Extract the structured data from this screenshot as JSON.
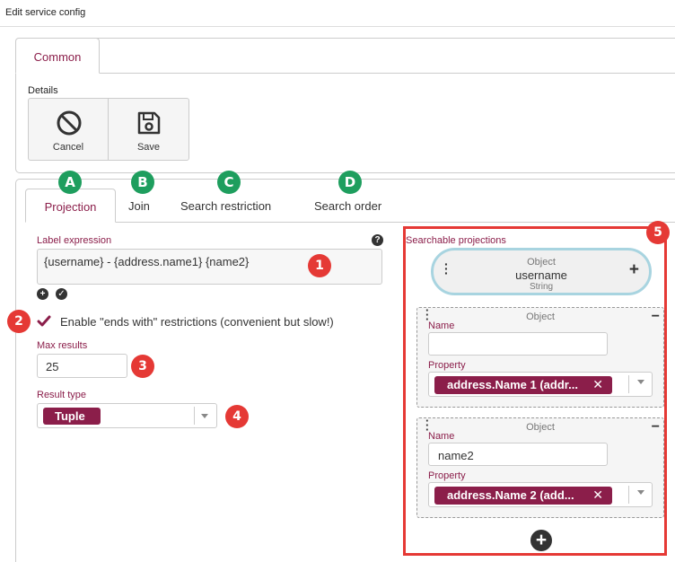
{
  "window": {
    "title": "Edit service config"
  },
  "top_tabs": [
    {
      "label": "Common"
    }
  ],
  "details": {
    "label": "Details",
    "cancel_label": "Cancel",
    "save_label": "Save"
  },
  "tabs": [
    {
      "label": "Projection",
      "badge": "A"
    },
    {
      "label": "Join",
      "badge": "B"
    },
    {
      "label": "Search restriction",
      "badge": "C"
    },
    {
      "label": "Search order",
      "badge": "D"
    }
  ],
  "projection": {
    "label_expression": {
      "label": "Label expression",
      "value": "{username} - {address.name1} {name2}",
      "help_icon": "question-circle-icon"
    },
    "ends_with": {
      "label": "Enable \"ends with\" restrictions (convenient but slow!)",
      "checked": true
    },
    "max_results": {
      "label": "Max results",
      "value": "25"
    },
    "result_type": {
      "label": "Result type",
      "value": "Tuple"
    }
  },
  "searchable": {
    "title": "Searchable projections",
    "root": {
      "type": "Object",
      "name": "username",
      "datatype": "String"
    },
    "items": [
      {
        "type": "Object",
        "name_label": "Name",
        "name_value": "",
        "property_label": "Property",
        "property_value": "address.Name 1 (addr..."
      },
      {
        "type": "Object",
        "name_label": "Name",
        "name_value": "name2",
        "property_label": "Property",
        "property_value": "address.Name 2 (add..."
      }
    ]
  },
  "annotations": [
    "1",
    "2",
    "3",
    "4",
    "5"
  ],
  "colors": {
    "accent": "#8b1e4a",
    "badge_green": "#1e9e5e",
    "badge_red": "#e53935",
    "highlight_border": "#e53935",
    "pill_border": "#a8d4e0"
  }
}
